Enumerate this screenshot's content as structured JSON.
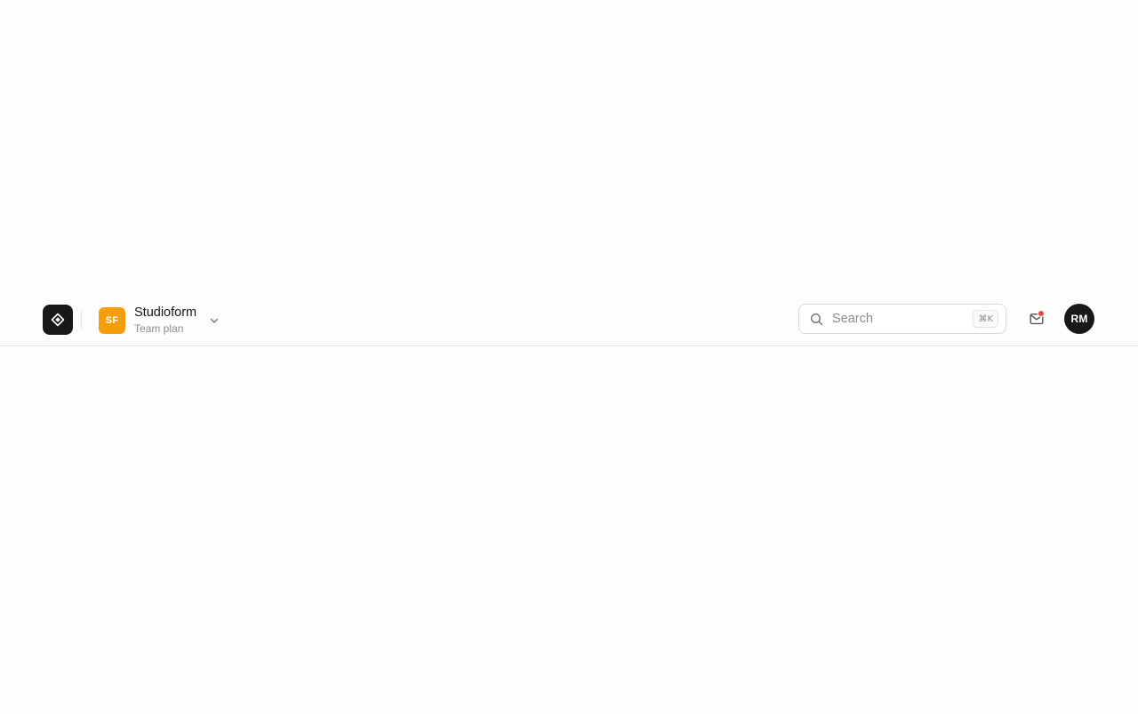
{
  "app": {
    "logo_icon": "diamond-logo-icon"
  },
  "workspace": {
    "initials": "SF",
    "name": "Studioform",
    "plan": "Team plan",
    "avatar_color": "#f59e0b",
    "switcher_icon": "chevron-down-icon"
  },
  "search": {
    "placeholder": "Search",
    "value": "",
    "shortcut": "⌘K",
    "icon": "search-icon"
  },
  "notifications": {
    "icon": "mail-icon",
    "has_unread": true,
    "dot_color": "#ef4444"
  },
  "user": {
    "initials": "RM",
    "avatar_color": "#18181b"
  }
}
